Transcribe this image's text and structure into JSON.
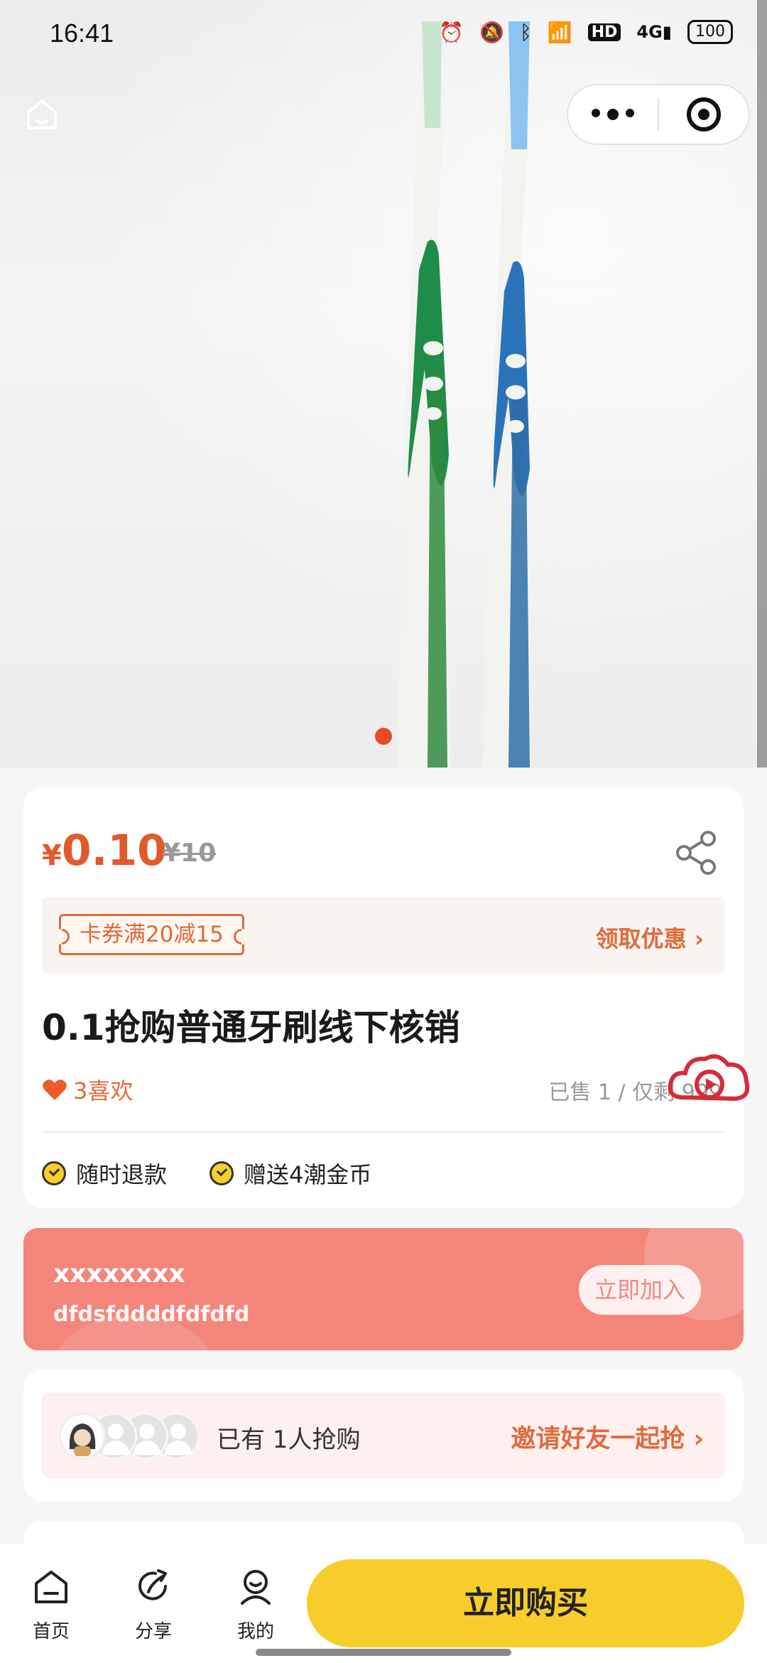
{
  "status_bar": {
    "time": "16:41",
    "icons": [
      "alarm-icon",
      "mute-icon",
      "bluetooth-icon",
      "wifi-icon",
      "hd-icon",
      "signal-4g-icon"
    ],
    "battery": "100"
  },
  "top_nav": {
    "home_icon": "home-icon",
    "more_icon": "more-dots-icon",
    "close_icon": "target-circle-icon"
  },
  "gallery": {
    "image": "two toothbrushes (green, blue)",
    "page_indicator_count": 1,
    "indicator_color": "#e84a26"
  },
  "product": {
    "currency": "¥",
    "price": "0.10",
    "original_price": "¥10",
    "coupon_label": "卡券满20减15",
    "coupon_link": "领取优惠",
    "title": "0.1抢购普通牙刷线下核销",
    "likes": "3喜欢",
    "sold_info": "已售 1 / 仅剩 999",
    "features": [
      "随时退款",
      "赠送4潮金币"
    ],
    "accent_color": "#e05a2b"
  },
  "member": {
    "title": "xxxxxxxx",
    "subtitle": "dfdsfddddfdfdfd",
    "button": "立即加入",
    "bg_color": "#f3857a"
  },
  "group_buy": {
    "count_text": "已有 1人抢购",
    "invite_text": "邀请好友一起抢"
  },
  "bottom_nav": {
    "items": [
      {
        "label": "首页",
        "icon": "home-icon"
      },
      {
        "label": "分享",
        "icon": "share-icon"
      },
      {
        "label": "我的",
        "icon": "profile-icon"
      }
    ],
    "buy_button": "立即购买",
    "buy_color": "#f7cd2c"
  }
}
